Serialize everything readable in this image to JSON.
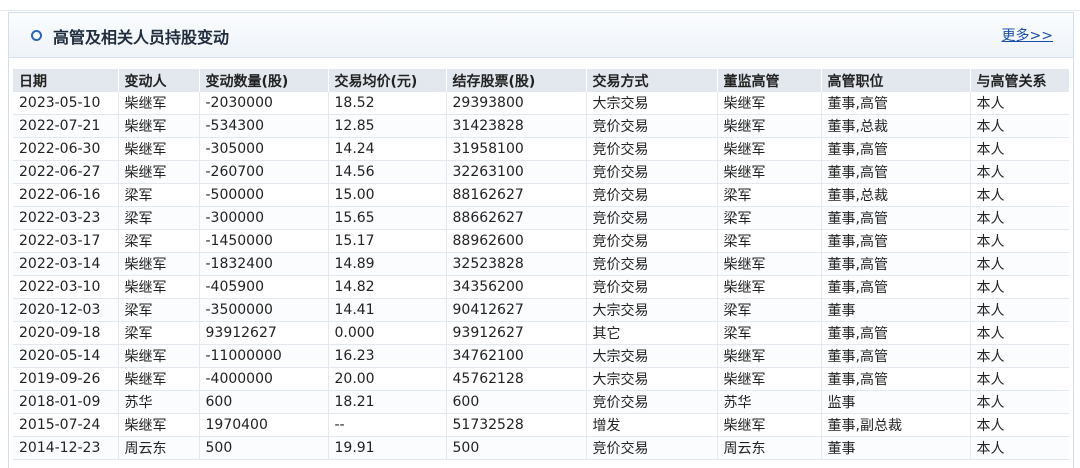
{
  "panel": {
    "title": "高管及相关人员持股变动",
    "more_link": "更多>>"
  },
  "table": {
    "headers": [
      "日期",
      "变动人",
      "变动数量(股)",
      "交易均价(元)",
      "结存股票(股)",
      "交易方式",
      "董监高管",
      "高管职位",
      "与高管关系"
    ],
    "rows": [
      [
        "2023-05-10",
        "柴继军",
        "-2030000",
        "18.52",
        "29393800",
        "大宗交易",
        "柴继军",
        "董事,高管",
        "本人"
      ],
      [
        "2022-07-21",
        "柴继军",
        "-534300",
        "12.85",
        "31423828",
        "竞价交易",
        "柴继军",
        "董事,总裁",
        "本人"
      ],
      [
        "2022-06-30",
        "柴继军",
        "-305000",
        "14.24",
        "31958100",
        "竞价交易",
        "柴继军",
        "董事,高管",
        "本人"
      ],
      [
        "2022-06-27",
        "柴继军",
        "-260700",
        "14.56",
        "32263100",
        "竞价交易",
        "柴继军",
        "董事,高管",
        "本人"
      ],
      [
        "2022-06-16",
        "梁军",
        "-500000",
        "15.00",
        "88162627",
        "竞价交易",
        "梁军",
        "董事,总裁",
        "本人"
      ],
      [
        "2022-03-23",
        "梁军",
        "-300000",
        "15.65",
        "88662627",
        "竞价交易",
        "梁军",
        "董事,高管",
        "本人"
      ],
      [
        "2022-03-17",
        "梁军",
        "-1450000",
        "15.17",
        "88962600",
        "竞价交易",
        "梁军",
        "董事,高管",
        "本人"
      ],
      [
        "2022-03-14",
        "柴继军",
        "-1832400",
        "14.89",
        "32523828",
        "竞价交易",
        "柴继军",
        "董事,高管",
        "本人"
      ],
      [
        "2022-03-10",
        "柴继军",
        "-405900",
        "14.82",
        "34356200",
        "竞价交易",
        "柴继军",
        "董事,高管",
        "本人"
      ],
      [
        "2020-12-03",
        "梁军",
        "-3500000",
        "14.41",
        "90412627",
        "大宗交易",
        "梁军",
        "董事",
        "本人"
      ],
      [
        "2020-09-18",
        "梁军",
        "93912627",
        "0.000",
        "93912627",
        "其它",
        "梁军",
        "董事,高管",
        "本人"
      ],
      [
        "2020-05-14",
        "柴继军",
        "-11000000",
        "16.23",
        "34762100",
        "大宗交易",
        "柴继军",
        "董事,高管",
        "本人"
      ],
      [
        "2019-09-26",
        "柴继军",
        "-4000000",
        "20.00",
        "45762128",
        "大宗交易",
        "柴继军",
        "董事,高管",
        "本人"
      ],
      [
        "2018-01-09",
        "苏华",
        "600",
        "18.21",
        "600",
        "竞价交易",
        "苏华",
        "监事",
        "本人"
      ],
      [
        "2015-07-24",
        "柴继军",
        "1970400",
        "--",
        "51732528",
        "增发",
        "柴继军",
        "董事,副总裁",
        "本人"
      ],
      [
        "2014-12-23",
        "周云东",
        "500",
        "19.91",
        "500",
        "竞价交易",
        "周云东",
        "董事",
        "本人"
      ]
    ]
  }
}
